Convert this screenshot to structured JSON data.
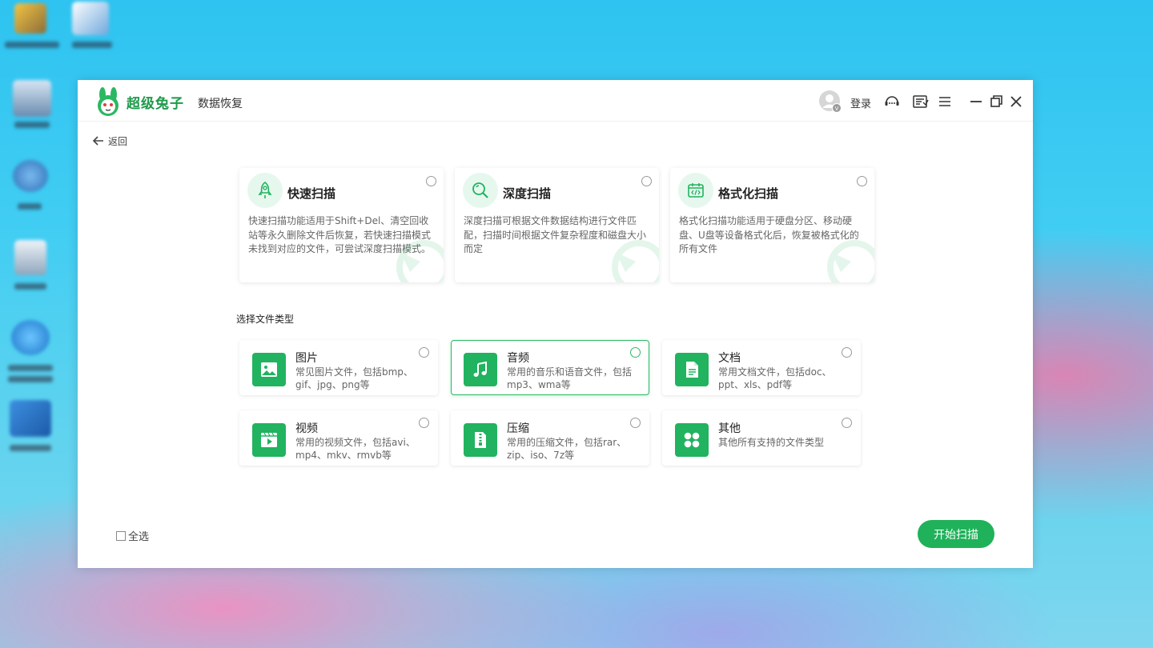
{
  "app": {
    "brand": "超级兔子",
    "product": "数据恢复",
    "login_label": "登录",
    "accent_color": "#1fb25a"
  },
  "nav": {
    "back_label": "返回"
  },
  "scan_modes": [
    {
      "id": "quick",
      "title": "快速扫描",
      "desc": "快速扫描功能适用于Shift+Del、清空回收站等永久删除文件后恢复，若快速扫描模式未找到对应的文件，可尝试深度扫描模式。",
      "icon": "rocket-icon",
      "selected": false
    },
    {
      "id": "deep",
      "title": "深度扫描",
      "desc": "深度扫描可根据文件数据结构进行文件匹配，扫描时间根据文件复杂程度和磁盘大小而定",
      "icon": "magnifier-icon",
      "selected": false
    },
    {
      "id": "format",
      "title": "格式化扫描",
      "desc": "格式化扫描功能适用于硬盘分区、移动硬盘、U盘等设备格式化后，恢复被格式化的所有文件",
      "icon": "calendar-code-icon",
      "selected": false
    }
  ],
  "file_types_label": "选择文件类型",
  "file_types": [
    {
      "id": "image",
      "title": "图片",
      "desc": "常见图片文件，包括bmp、gif、jpg、png等",
      "icon": "image-icon",
      "selected": false
    },
    {
      "id": "audio",
      "title": "音频",
      "desc": "常用的音乐和语音文件，包括mp3、wma等",
      "icon": "music-note-icon",
      "selected": true
    },
    {
      "id": "document",
      "title": "文档",
      "desc": "常用文档文件，包括doc、ppt、xls、pdf等",
      "icon": "document-icon",
      "selected": false
    },
    {
      "id": "video",
      "title": "视频",
      "desc": "常用的视频文件，包括avi、mp4、mkv、rmvb等",
      "icon": "video-icon",
      "selected": false
    },
    {
      "id": "archive",
      "title": "压缩",
      "desc": "常用的压缩文件，包括rar、zip、iso、7z等",
      "icon": "zip-icon",
      "selected": false
    },
    {
      "id": "other",
      "title": "其他",
      "desc": "其他所有支持的文件类型",
      "icon": "grid-icon",
      "selected": false
    }
  ],
  "footer": {
    "select_all_label": "全选",
    "start_scan_label": "开始扫描"
  }
}
